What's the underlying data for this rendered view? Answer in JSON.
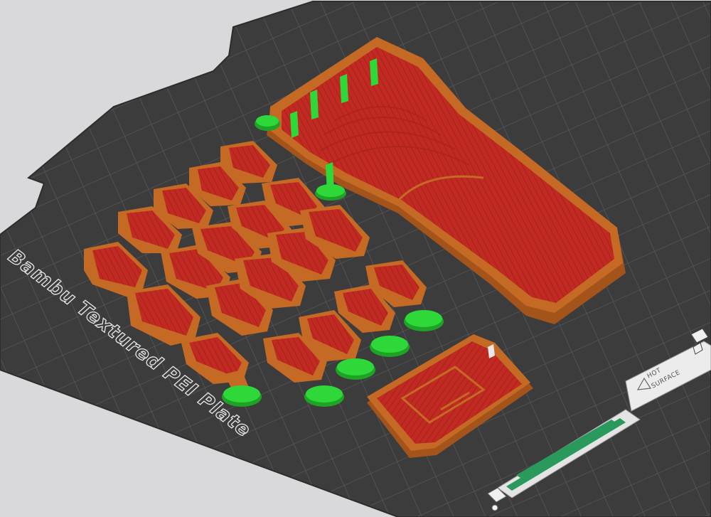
{
  "viewport": {
    "background": "#d9d9db"
  },
  "plate": {
    "label": "Bambu Textured PEI Plate",
    "surface_color": "#3c3c3d",
    "grid_color": "#56565a",
    "warning_line1": "HOT",
    "warning_line2": "SURFACE"
  },
  "colors": {
    "filament_body": "#c56a24",
    "filament_wall": "#a4541a",
    "infill": "#c12a22",
    "support": "#2fd839",
    "support_dark": "#1ea327",
    "sticker_bar": "#2a9a5c"
  },
  "icons": [
    "plate-lock-icon",
    "bed-corner-icon",
    "bed-handle-icon",
    "warning-triangle-icon"
  ]
}
